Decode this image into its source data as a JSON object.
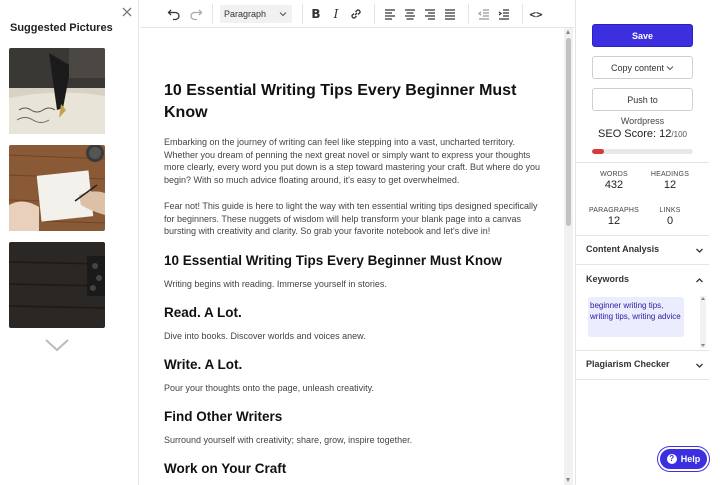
{
  "sidebar": {
    "title": "Suggested Pictures"
  },
  "toolbar": {
    "block_format": "Paragraph",
    "bold": "B",
    "italic": "I",
    "code": "<>"
  },
  "article": {
    "title": "10 Essential Writing Tips Every Beginner Must Know",
    "intro_1": "Embarking on the journey of writing can feel like stepping into a vast, uncharted territory. Whether you dream of penning the next great novel or simply want to express your thoughts more clearly, every word you put down is a step toward mastering your craft. But where do you begin? With so much advice floating around, it's easy to get overwhelmed.",
    "intro_2": "Fear not! This guide is here to light the way with ten essential writing tips designed specifically for beginners. These nuggets of wisdom will help transform your blank page into a canvas bursting with creativity and clarity. So grab your favorite notebook and let's dive in!",
    "sections": [
      {
        "heading": "10 Essential Writing Tips Every Beginner Must Know",
        "body": "Writing begins with reading. Immerse yourself in stories."
      },
      {
        "heading": "Read. A Lot.",
        "body": "Dive into books. Discover worlds and voices anew."
      },
      {
        "heading": "Write. A Lot.",
        "body": "Pour your thoughts onto the page, unleash creativity."
      },
      {
        "heading": "Find Other Writers",
        "body": "Surround yourself with creativity; share, grow, inspire together."
      },
      {
        "heading": "Work on Your Craft",
        "body": ""
      }
    ]
  },
  "panel": {
    "save_label": "Save",
    "copy_label": "Copy content",
    "push_label": "Push to",
    "platform": "Wordpress",
    "seo_label": "SEO Score:",
    "seo_value": "12",
    "seo_max": "/100",
    "seo_fraction": 0.12,
    "stats": {
      "words_label": "WORDS",
      "words": "432",
      "headings_label": "HEADINGS",
      "headings": "12",
      "paragraphs_label": "PARAGRAPHS",
      "paragraphs": "12",
      "links_label": "LINKS",
      "links": "0"
    },
    "content_analysis": "Content Analysis",
    "keywords_label": "Keywords",
    "keywords": "beginner writing tips, writing tips, writing advice",
    "plagiarism": "Plagiarism Checker",
    "help_label": "Help"
  },
  "colors": {
    "accent": "#3b2fe0",
    "seo_bar": "#d63a3a",
    "keyword_bg": "#ececff"
  }
}
